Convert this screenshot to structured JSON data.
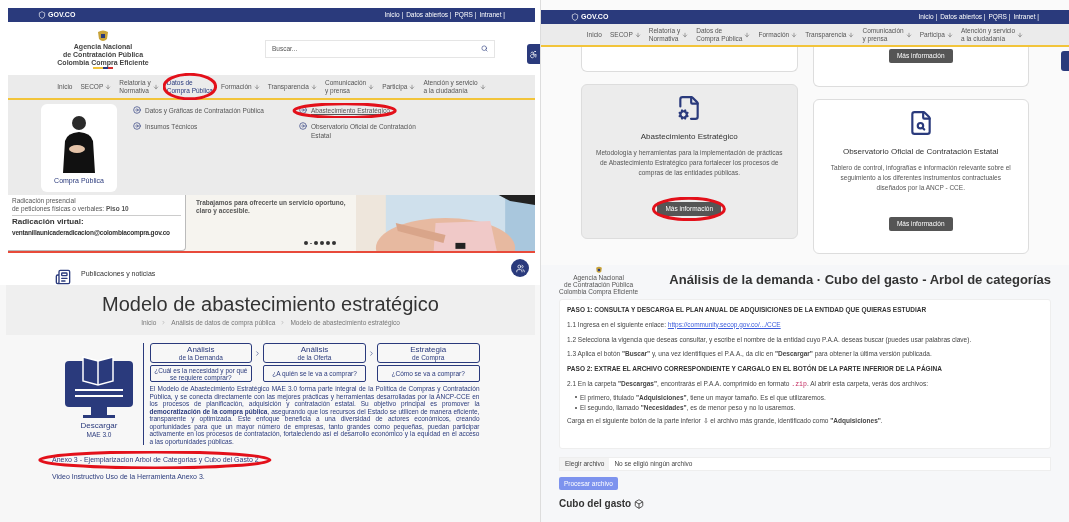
{
  "left_top": {
    "gov_bar": {
      "brand": "GOV.CO",
      "links": [
        "Inicio |",
        "Datos abiertos |",
        "PQRS |",
        "Intranet |"
      ]
    },
    "agency_name": [
      "Agencia Nacional",
      "de Contratación Pública",
      "Colombia Compra Eficiente"
    ],
    "search": {
      "placeholder": "Buscar..."
    },
    "nav": [
      {
        "label": "Inicio",
        "dropdown": false,
        "circled": false
      },
      {
        "label": "SECOP",
        "dropdown": true,
        "circled": false
      },
      {
        "label": "Relatoría y\nNormativa",
        "dropdown": true,
        "circled": false
      },
      {
        "label": "Datos de\nCompra Pública",
        "dropdown": false,
        "circled": true
      },
      {
        "label": "Formación",
        "dropdown": true,
        "circled": false
      },
      {
        "label": "Transparencia",
        "dropdown": true,
        "circled": false
      },
      {
        "label": "Comunicación\ny prensa",
        "dropdown": true,
        "circled": false
      },
      {
        "label": "Participa",
        "dropdown": true,
        "circled": false
      },
      {
        "label": "Atención y servicio\na la ciudadanía",
        "dropdown": true,
        "circled": false
      }
    ],
    "menu": {
      "card_label": "Compra Pública",
      "columns": [
        [
          {
            "label": "Datos y Gráficas de Contratación Pública",
            "circled": false
          },
          {
            "label": "Insumos Técnicos",
            "circled": false
          }
        ],
        [
          {
            "label": "Abastecimiento Estratégico",
            "circled": true
          },
          {
            "label": "Observatorio Oficial de Contratación Estatal",
            "circled": false
          }
        ]
      ]
    },
    "banner": {
      "office_text": "Radicación presencial\nde peticiones físicas o verbales: **Piso 10**",
      "virtual_title": "Radicación virtual:",
      "email": "ventanillaunicaderadicacion@colombiacompra.gov.co",
      "message": "Trabajamos para ofrecerte un servicio oportuno, claro y accesible.",
      "slides": [
        {
          "selected": false
        },
        {
          "selected": true
        },
        {
          "selected": false
        },
        {
          "selected": false
        },
        {
          "selected": false
        },
        {
          "selected": false
        }
      ]
    },
    "section_title": "Publicaciones y noticias"
  },
  "left_bottom": {
    "title": "Modelo de abastecimiento estratégico",
    "breadcrumb": [
      "Inicio",
      "Análisis de datos de compra pública",
      "Modelo de abastecimiento estratégico"
    ],
    "download": {
      "label": "Descargar",
      "version": "MAE 3.0"
    },
    "stages": [
      {
        "title": "Análisis",
        "subtitle": "de la Demanda",
        "question": "¿Cuál es la necesidad y por qué se requiere comprar?"
      },
      {
        "title": "Análisis",
        "subtitle": "de la Oferta",
        "question": "¿A quién se le va a comprar?"
      },
      {
        "title": "Estrategia",
        "subtitle": "de Compra",
        "question": "¿Cómo se va a comprar?"
      }
    ],
    "description": "El Modelo de Abastecimiento Estratégico MAE 3.0 forma parte integral de la Política de Compras y Contratación Pública, y se conecta directamente con las mejores prácticas y herramientas desarrolladas por la ANCP-CCE en los procesos de planificación, adquisición y contratación estatal. Su objetivo principal es promover la **democratización de la compra pública**, asegurando que los recursos del Estado se utilicen de manera eficiente, transparente y optimizada. Este enfoque beneficia a una diversidad de actores económicos, creando oportunidades para que un mayor número de empresas, tanto grandes como pequeñas, puedan participar activamente en los procesos de contratación, fortaleciendo así el desarrollo económico y la equidad en el acceso a las oportunidades públicas.",
    "links": [
      {
        "label": "Anexo 3 - Ejemplarizacion Arbol de Categorias y Cubo del Gasto 2",
        "circled": true
      },
      {
        "label": "Video Instructivo Uso de la Herramienta Anexo 3.",
        "circled": false
      }
    ]
  },
  "right_top": {
    "gov_bar": {
      "brand": "GOV.CO",
      "links": [
        "Inicio |",
        "Datos abiertos |",
        "PQRS |",
        "Intranet |"
      ]
    },
    "nav": [
      {
        "label": "Inicio",
        "dropdown": false
      },
      {
        "label": "SECOP",
        "dropdown": true
      },
      {
        "label": "Relatoría y\nNormativa",
        "dropdown": true
      },
      {
        "label": "Datos de\nCompra Pública",
        "dropdown": true
      },
      {
        "label": "Formación",
        "dropdown": true
      },
      {
        "label": "Transparencia",
        "dropdown": true
      },
      {
        "label": "Comunicación\ny prensa",
        "dropdown": true
      },
      {
        "label": "Participa",
        "dropdown": true
      },
      {
        "label": "Atención y servicio\na la ciudadanía",
        "dropdown": true
      }
    ],
    "partial_card_button": "Más información",
    "cards": [
      {
        "kind": "document-gear",
        "title": "Abastecimiento Estratégico",
        "description": "Metodología y herramientas para la implementación de prácticas de Abastecimiento Estratégico para fortalecer los procesos de compras de las entidades públicas.",
        "button": "Más información",
        "highlighted": true,
        "circled": true
      },
      {
        "kind": "document-search",
        "title": "Observatorio Oficial de Contratación Estatal",
        "description": "Tablero de control, infografías e información relevante sobre el seguimiento a los diferentes instrumentos contractuales diseñados por la ANCP - CCE.",
        "button": "Más información",
        "highlighted": false,
        "circled": false
      }
    ]
  },
  "right_bottom": {
    "logo_text": [
      "Agencia Nacional",
      "de Contratación Pública",
      "Colombia Compra Eficiente"
    ],
    "title": "Análisis de la demanda · Cubo del gasto - Arbol de categorías",
    "steps": [
      {
        "kind": "heading",
        "text": "PASO 1: CONSULTA Y DESCARGA EL PLAN ANUAL DE ADQUISICIONES DE LA ENTIDAD QUE QUIERAS ESTUDIAR"
      },
      {
        "kind": "link",
        "text": "1.1 Ingresa en el siguiente enlace:",
        "link": "https://community.secop.gov.co/.../CCE"
      },
      {
        "kind": "paragraph",
        "text": "1.2 Selecciona la vigencia que deseas consultar, y escribe el nombre de la entidad cuyo P.A.A. deseas buscar (puedes usar palabras clave)."
      },
      {
        "kind": "paragraph",
        "text": "1.3 Aplica el botón **\"Buscar\"** y, una vez identifiques el P.A.A., da clic en **\"Descargar\"** para obtener la última versión publicada."
      },
      {
        "kind": "heading",
        "text": "PASO 2: EXTRAE EL ARCHIVO CORRESPONDIENTE Y CARGALO EN EL BOTÓN DE LA PARTE INFERIOR DE LA PÁGINA"
      },
      {
        "kind": "code",
        "text": "2.1 En la carpeta **\"Descargas\"**, encontrarás el P.A.A. comprimido en formato",
        "code": ".zip",
        "after": ". Al abrir esta carpeta, verás dos archivos:"
      },
      {
        "kind": "bullet",
        "text": "El primero, titulado **\"Adquisiciones\"**, tiene un mayor tamaño. Es el que utilizaremos."
      },
      {
        "kind": "bullet",
        "text": "El segundo, llamado **\"Necesidades\"**, es de menor peso y no lo usaremos."
      },
      {
        "kind": "paragraph",
        "text": "Carga en el siguiente botón de la parte inferior ⇩ el archivo más grande, identificado como **\"Adquisiciones\"**."
      }
    ],
    "file_input": {
      "button": "Elegir archivo",
      "value": "No se eligió ningún archivo"
    },
    "process_button": {
      "label": "Procesar archivo",
      "disabled": true
    },
    "section_title": "Cubo del gasto"
  }
}
